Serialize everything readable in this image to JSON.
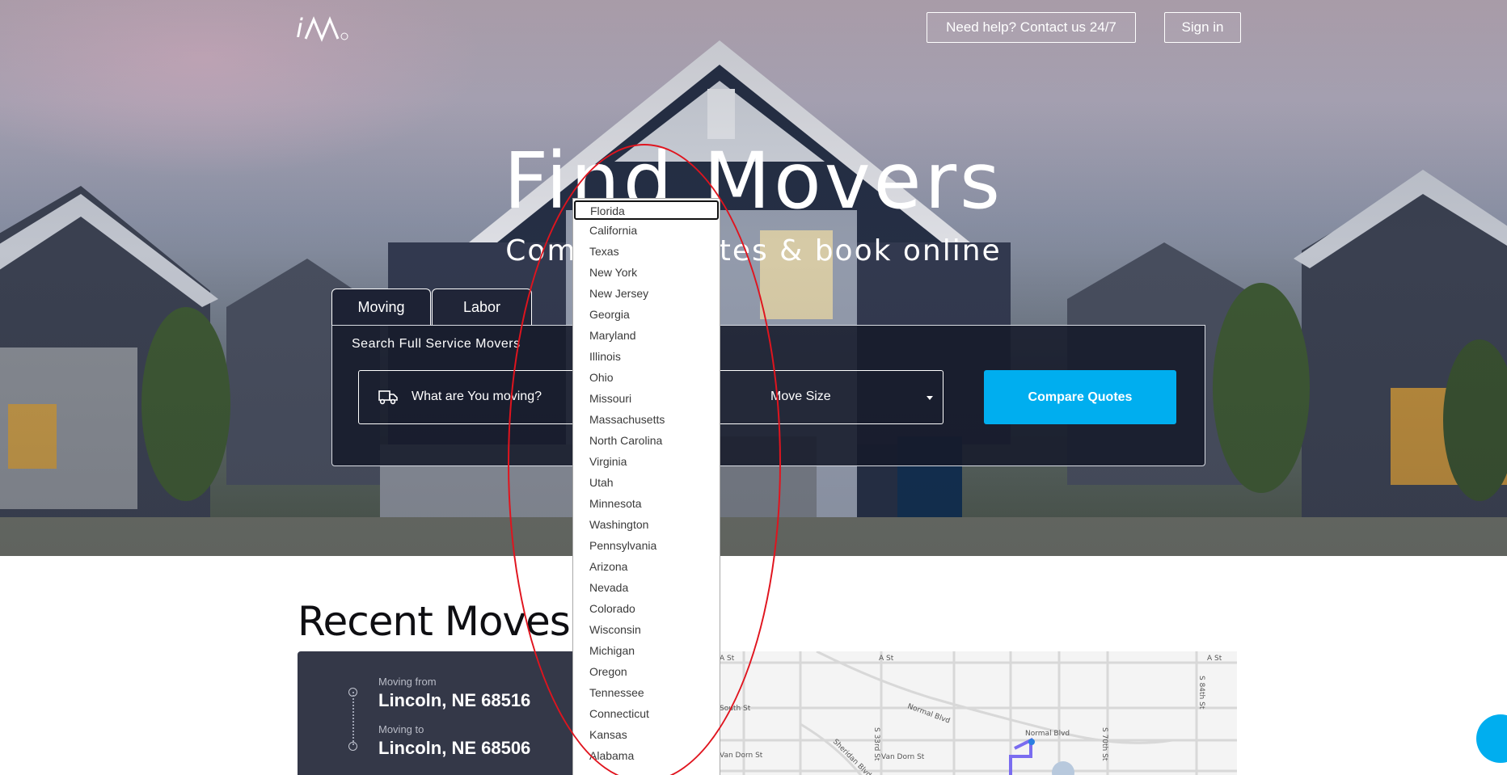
{
  "header": {
    "help_label": "Need help? Contact us 24/7",
    "signin_label": "Sign in"
  },
  "hero": {
    "title": "Find Movers",
    "subtitle": "Compare quotes & book online"
  },
  "tabs": [
    {
      "label": "Moving",
      "active": true
    },
    {
      "label": "Labor",
      "active": false
    }
  ],
  "search": {
    "panel_label": "Search Full Service Movers",
    "what_placeholder": "What are You moving?",
    "size_placeholder": "Move Size",
    "compare_label": "Compare Quotes"
  },
  "dropdown": {
    "selected": "Florida",
    "options": [
      "Florida",
      "California",
      "Texas",
      "New York",
      "New Jersey",
      "Georgia",
      "Maryland",
      "Illinois",
      "Ohio",
      "Missouri",
      "Massachusetts",
      "North Carolina",
      "Virginia",
      "Utah",
      "Minnesota",
      "Washington",
      "Pennsylvania",
      "Arizona",
      "Nevada",
      "Colorado",
      "Wisconsin",
      "Michigan",
      "Oregon",
      "Tennessee",
      "Connecticut",
      "Kansas",
      "Alabama"
    ]
  },
  "recent": {
    "title": "Recent Moves",
    "from_label": "Moving from",
    "from_value": "Lincoln, NE 68516",
    "to_label": "Moving to",
    "to_value": "Lincoln, NE 68506"
  },
  "map": {
    "labels": [
      "A St",
      "A St",
      "A St",
      "South St",
      "Normal Blvd",
      "Normal Blvd",
      "Van Dorn St",
      "Van Dorn St",
      "Sheridan Blvd",
      "S 33rd St",
      "S 70th St",
      "S 84th St"
    ]
  },
  "colors": {
    "accent": "#00aeef",
    "panel": "#161a2a",
    "card": "#343848",
    "annotation": "#e0141e"
  }
}
